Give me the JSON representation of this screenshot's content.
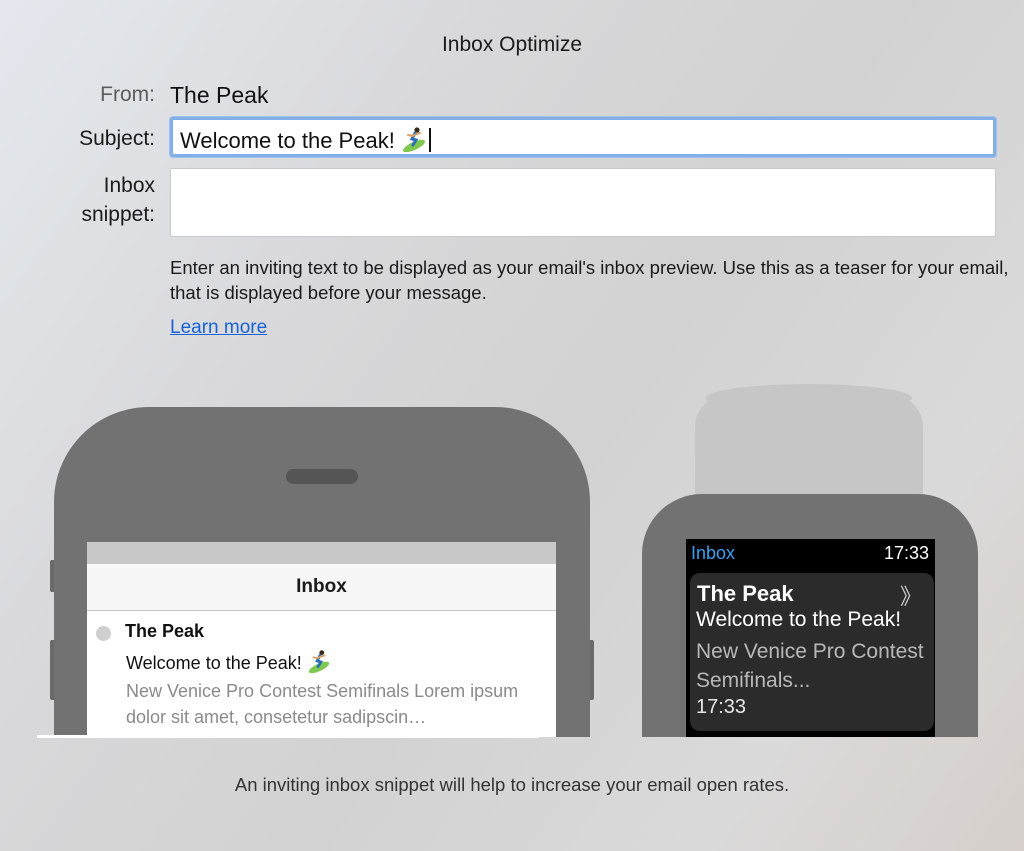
{
  "window": {
    "title": "Inbox Optimize"
  },
  "form": {
    "from_label": "From:",
    "from_value": "The Peak",
    "subject_label": "Subject:",
    "subject_value": "Welcome to the Peak!",
    "subject_emoji": "surfer-icon",
    "snippet_label_line1": "Inbox",
    "snippet_label_line2": "snippet:",
    "snippet_value": "",
    "help_text": "Enter an inviting text to be displayed as your email's inbox preview. Use this as a teaser for your email, that is displayed before your message.",
    "learn_more": "Learn more"
  },
  "phone_preview": {
    "nav_title": "Inbox",
    "sender": "The Peak",
    "subject": "Welcome to the Peak!",
    "preview": "New Venice Pro Contest Semifinals Lorem ipsum dolor sit amet, consetetur sadipscin…"
  },
  "watch_preview": {
    "inbox_label": "Inbox",
    "time": "17:33",
    "sender": "The Peak",
    "chevron": "》",
    "subject": "Welcome to the Peak!",
    "preview": "New Venice Pro Contest Semifinals...",
    "message_time": "17:33"
  },
  "footer": {
    "text": "An inviting inbox snippet will help to increase your email open rates."
  },
  "colors": {
    "accent": "#1763d6",
    "focus_ring": "#82afe8",
    "watch_inbox": "#3aa0f0",
    "device_gray": "#727272"
  }
}
